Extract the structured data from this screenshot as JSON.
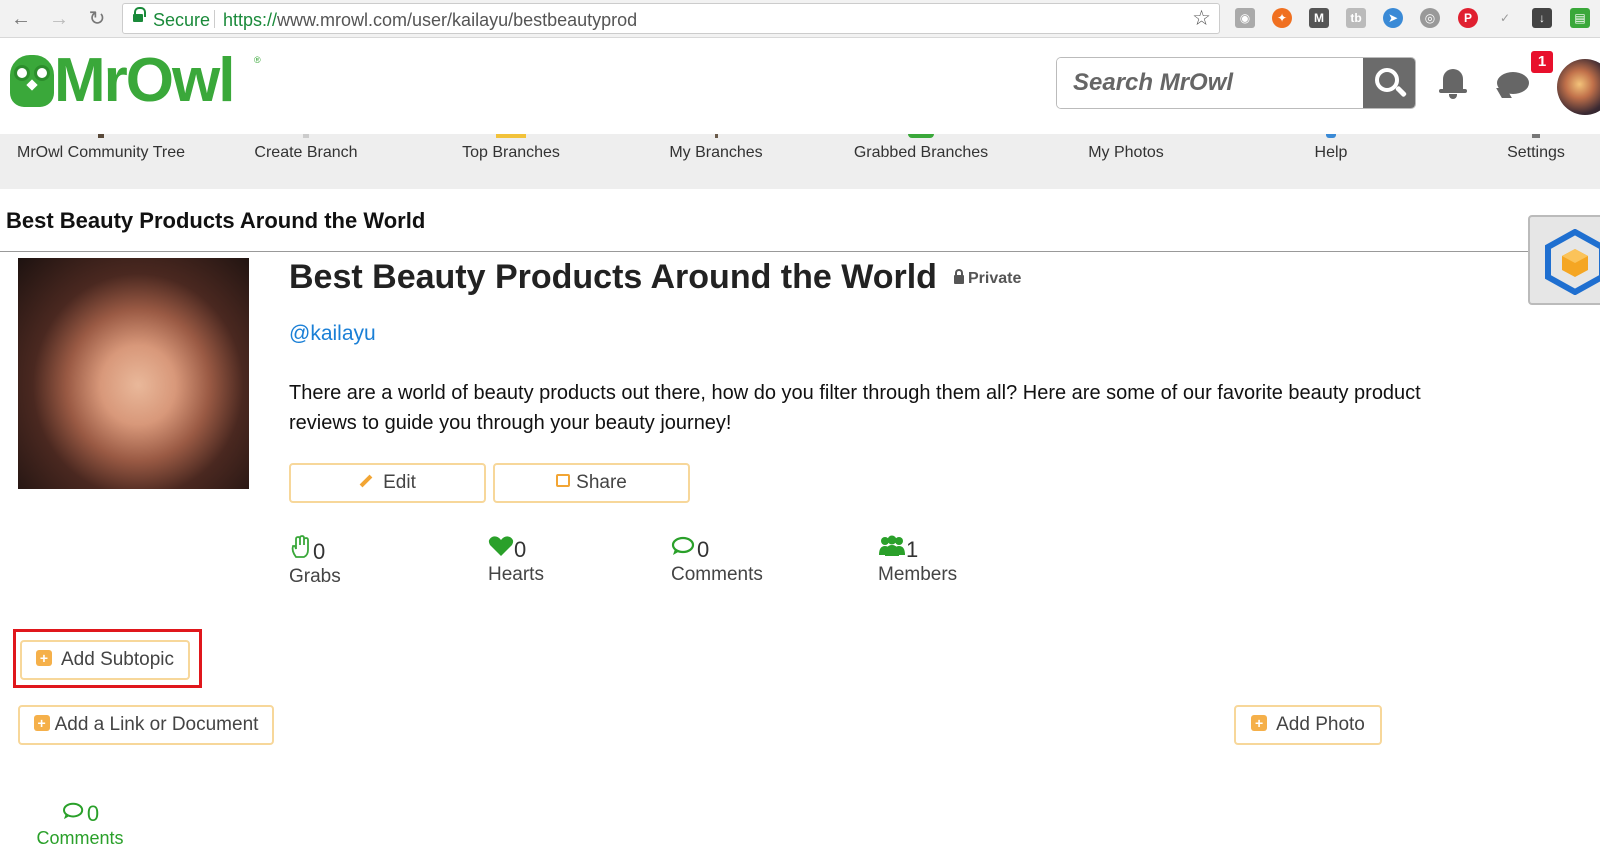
{
  "browser": {
    "secure_label": "Secure",
    "url_scheme": "https://",
    "url_rest": "www.mrowl.com/user/kailayu/bestbeautyprod"
  },
  "site": {
    "logo_text": "MrOwl",
    "search_placeholder": "Search MrOwl",
    "notification_count": "1"
  },
  "categories": [
    {
      "label": "MrOwl Community Tree",
      "stub_color": "#5a4a3a"
    },
    {
      "label": "Create Branch",
      "stub_color": "#cccccc"
    },
    {
      "label": "Top Branches",
      "stub_color": "#f2c23a"
    },
    {
      "label": "My Branches",
      "stub_color": "#6a5a4a"
    },
    {
      "label": "Grabbed Branches",
      "stub_color": "#3aa83a"
    },
    {
      "label": "My Photos",
      "stub_color": "#eeeeee"
    },
    {
      "label": "Help",
      "stub_color": "#3a8ad6"
    },
    {
      "label": "Settings",
      "stub_color": "#777777"
    }
  ],
  "branch": {
    "bar_title": "Best Beauty Products Around the World",
    "title": "Best Beauty Products Around the World",
    "privacy": "Private",
    "owner_handle": "@kailayu",
    "description": "There are a world of beauty products out there, how do you filter through them all? Here are some of our favorite beauty product reviews to guide you through your beauty journey!",
    "edit_label": "Edit",
    "share_label": "Share"
  },
  "stats": {
    "grabs": {
      "count": "0",
      "label": "Grabs"
    },
    "hearts": {
      "count": "0",
      "label": "Hearts"
    },
    "comments": {
      "count": "0",
      "label": "Comments"
    },
    "members": {
      "count": "1",
      "label": "Members"
    }
  },
  "actions": {
    "add_subtopic": "Add Subtopic",
    "add_link": "Add a Link or Document",
    "add_photo": "Add Photo"
  },
  "footer_comments": {
    "count": "0",
    "label": "Comments"
  },
  "colors": {
    "brand_green": "#3aa83a",
    "accent_orange": "#f5b04a",
    "link_blue": "#1a7fd6",
    "highlight_red": "#e0171c"
  }
}
